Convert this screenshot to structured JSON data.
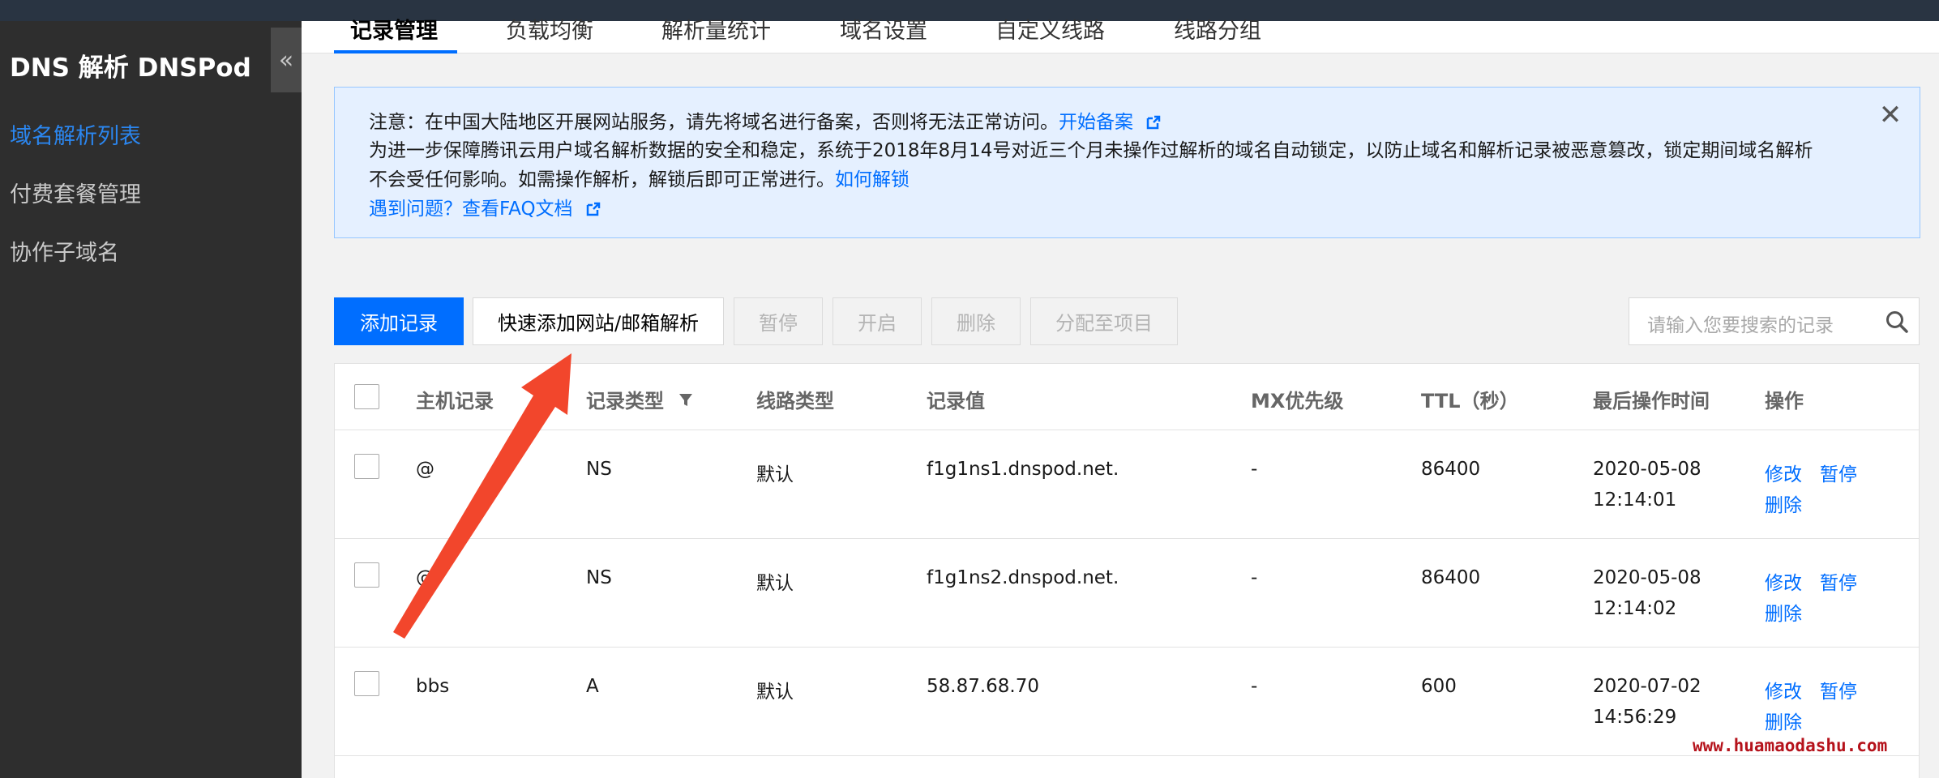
{
  "app_title": "DNS 解析 DNSPod",
  "collapse_glyph": "«",
  "sidebar": {
    "items": [
      {
        "label": "域名解析列表",
        "active": true
      },
      {
        "label": "付费套餐管理",
        "active": false
      },
      {
        "label": "协作子域名",
        "active": false
      }
    ]
  },
  "tabs": [
    {
      "label": "记录管理",
      "active": true
    },
    {
      "label": "负载均衡",
      "active": false
    },
    {
      "label": "解析量统计",
      "active": false
    },
    {
      "label": "域名设置",
      "active": false
    },
    {
      "label": "自定义线路",
      "active": false
    },
    {
      "label": "线路分组",
      "active": false
    }
  ],
  "notice": {
    "line1_text": "注意：在中国大陆地区开展网站服务，请先将域名进行备案，否则将无法正常访问。",
    "line1_link": "开始备案",
    "line2_text": "为进一步保障腾讯云用户域名解析数据的安全和稳定，系统于2018年8月14号对近三个月未操作过解析的域名自动锁定，以防止域名和解析记录被恶意篡改，锁定期间域名解析",
    "line3_text": "不会受任何影响。如需操作解析，解锁后即可正常进行。",
    "line3_link": "如何解锁",
    "line4_link": "遇到问题？查看FAQ文档",
    "close_glyph": "✕"
  },
  "toolbar": {
    "add_record": "添加记录",
    "quick_add": "快速添加网站/邮箱解析",
    "pause": "暂停",
    "enable": "开启",
    "delete": "删除",
    "assign": "分配至项目"
  },
  "search": {
    "placeholder": "请输入您要搜索的记录"
  },
  "table": {
    "headers": {
      "host": "主机记录",
      "type": "记录类型",
      "line": "线路类型",
      "value": "记录值",
      "mx": "MX优先级",
      "ttl": "TTL（秒）",
      "time": "最后操作时间",
      "ops": "操作"
    },
    "rows": [
      {
        "host": "@",
        "type": "NS",
        "line": "默认",
        "value": "f1g1ns1.dnspod.net.",
        "mx": "-",
        "ttl": "86400",
        "date": "2020-05-08",
        "time": "12:14:01",
        "edit": "修改",
        "pause": "暂停",
        "delete": "删除"
      },
      {
        "host": "@",
        "type": "NS",
        "line": "默认",
        "value": "f1g1ns2.dnspod.net.",
        "mx": "-",
        "ttl": "86400",
        "date": "2020-05-08",
        "time": "12:14:02",
        "edit": "修改",
        "pause": "暂停",
        "delete": "删除"
      },
      {
        "host": "bbs",
        "type": "A",
        "line": "默认",
        "value": "58.87.68.70",
        "mx": "-",
        "ttl": "600",
        "date": "2020-07-02",
        "time": "14:56:29",
        "edit": "修改",
        "pause": "暂停",
        "delete": "删除"
      }
    ]
  },
  "watermark": "www.huamaodashu.com",
  "colors": {
    "accent": "#006eff",
    "sidebar_bg": "#2e2e2e",
    "annotation_arrow": "#f2462c"
  }
}
